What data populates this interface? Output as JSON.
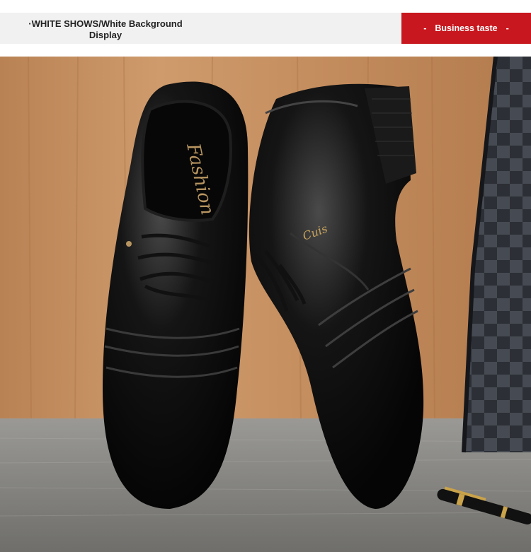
{
  "header": {
    "title_line1": "·WHITE SHOWS/White Background",
    "title_line2": "Display",
    "badge_dash_left": "-",
    "badge_label": "Business taste",
    "badge_dash_right": "-"
  },
  "photo": {
    "subject": "pair of black leather oxford shoes",
    "insole_text": "Fashion",
    "colors": {
      "wood": "#c99466",
      "carpet": "#8a8986",
      "leather": "#0c0c0c",
      "accent_red": "#c8171e"
    }
  }
}
